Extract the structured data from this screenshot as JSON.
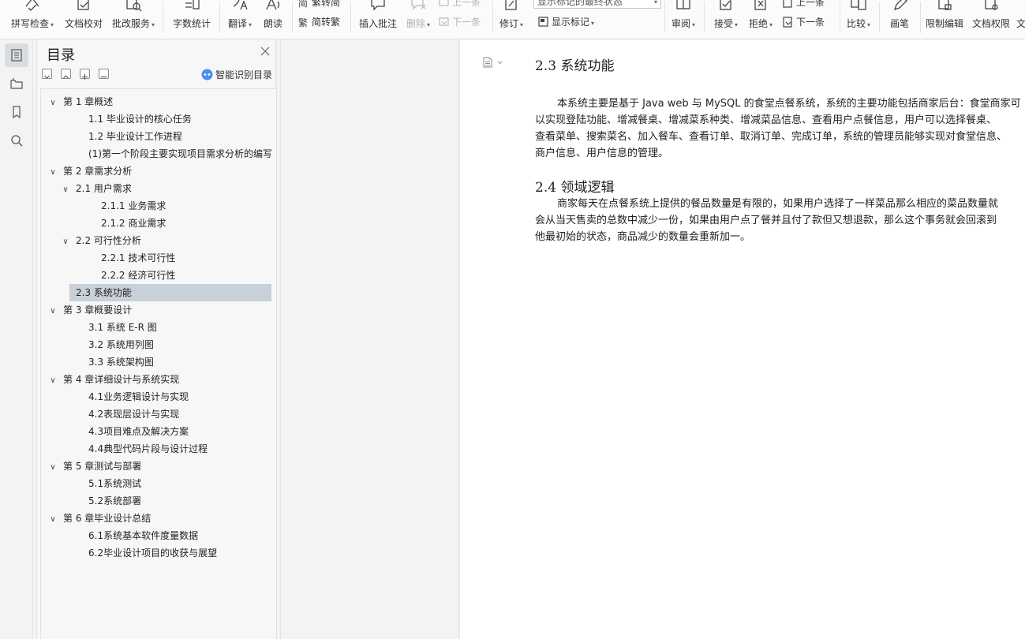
{
  "ribbon": {
    "spell_check": "拼写检查",
    "doc_proof": "文档校对",
    "review_service": "批改服务",
    "word_count": "字数统计",
    "translate": "翻译",
    "read_aloud": "朗读",
    "trad_to_simp": "繁转简",
    "simp_to_trad": "简转繁",
    "insert_comment": "插入批注",
    "delete": "删除",
    "prev_comment": "上一条",
    "next_comment": "下一条",
    "track_changes": "修订",
    "markup_select": "显示标记的最终状态",
    "show_markup": "显示标记",
    "reviewing": "审阅",
    "accept": "接受",
    "reject": "拒绝",
    "prev_change": "上一条",
    "next_change": "下一条",
    "compare": "比较",
    "pen": "画笔",
    "restrict_editing": "限制编辑",
    "doc_permission": "文档权限",
    "more_cut": "文"
  },
  "nav": {
    "title": "目录",
    "smart_toc": "智能识别目录",
    "items": [
      {
        "level": 1,
        "text": "第 1 章概述",
        "expanded": true
      },
      {
        "level": 2,
        "text": "1.1 毕业设计的核心任务"
      },
      {
        "level": 2,
        "text": "1.2 毕业设计工作进程"
      },
      {
        "level": 2,
        "text": "(1)第一个阶段主要实现项目需求分析的编写 ..."
      },
      {
        "level": 1,
        "text": "第 2 章需求分析",
        "expanded": true
      },
      {
        "level": 2,
        "text": "2.1 用户需求",
        "expanded": true
      },
      {
        "level": 3,
        "text": "2.1.1 业务需求"
      },
      {
        "level": 3,
        "text": "2.1.2 商业需求"
      },
      {
        "level": 2,
        "text": "2.2 可行性分析",
        "expanded": true
      },
      {
        "level": 3,
        "text": "2.2.1 技术可行性"
      },
      {
        "level": 3,
        "text": "2.2.2 经济可行性"
      },
      {
        "level": 2,
        "text": "2.3 系统功能",
        "selected": true
      },
      {
        "level": 1,
        "text": "第 3 章概要设计",
        "expanded": true
      },
      {
        "level": 2,
        "text": "3.1 系统 E-R 图"
      },
      {
        "level": 2,
        "text": "3.2 系统用列图"
      },
      {
        "level": 2,
        "text": "3.3 系统架构图"
      },
      {
        "level": 1,
        "text": "第 4 章详细设计与系统实现",
        "expanded": true
      },
      {
        "level": 2,
        "text": "4.1业务逻辑设计与实现"
      },
      {
        "level": 2,
        "text": "4.2表现层设计与实现"
      },
      {
        "level": 2,
        "text": "4.3项目难点及解决方案"
      },
      {
        "level": 2,
        "text": "4.4典型代码片段与设计过程"
      },
      {
        "level": 1,
        "text": "第 5 章测试与部署",
        "expanded": true
      },
      {
        "level": 2,
        "text": "5.1系统测试"
      },
      {
        "level": 2,
        "text": "5.2系统部署"
      },
      {
        "level": 1,
        "text": "第 6 章毕业设计总结",
        "expanded": true
      },
      {
        "level": 2,
        "text": "6.1系统基本软件度量数据"
      },
      {
        "level": 2,
        "text": "6.2毕业设计项目的收获与展望"
      }
    ]
  },
  "document": {
    "section1_heading": "2.3 系统功能",
    "section1_lines": [
      "本系统主要是基于 Java web 与 MySQL 的食堂点餐系统，系统的主要功能包括商家后台：食堂商家可",
      "以实现登陆功能、增减餐桌、增减菜系种类、增减菜品信息、查看用户点餐信息，用户可以选择餐桌、",
      "查看菜单、搜索菜名、加入餐车、查看订单、取消订单、完成订单，系统的管理员能够实现对食堂信息、",
      "商户信息、用户信息的管理。"
    ],
    "section2_heading": "2.4 领域逻辑",
    "section2_lines": [
      "商家每天在点餐系统上提供的餐品数量是有限的，如果用户选择了一样菜品那么相应的菜品数量就",
      "会从当天售卖的总数中减少一份，如果由用户点了餐并且付了款但又想退款，那么这个事务就会回滚到",
      "他最初始的状态，商品减少的数量会重新加一。"
    ]
  }
}
